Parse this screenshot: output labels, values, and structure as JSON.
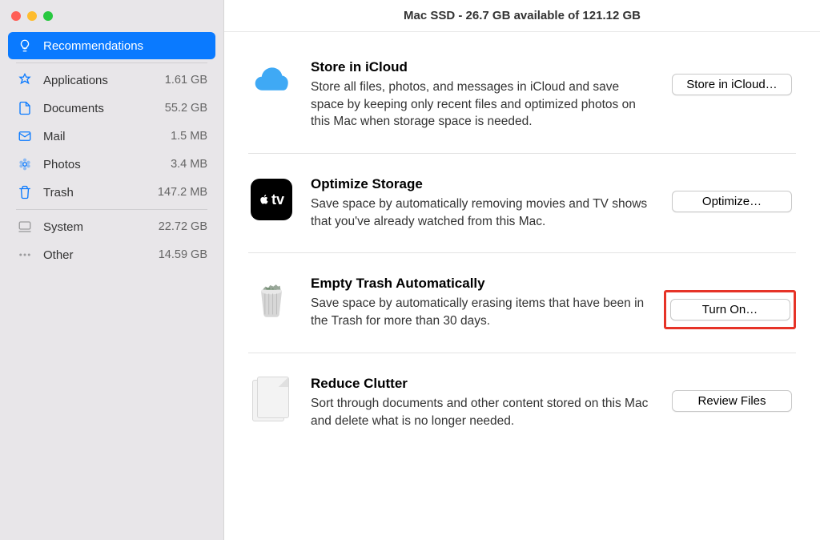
{
  "titlebar": "Mac SSD - 26.7 GB available of 121.12 GB",
  "sidebar": {
    "items": [
      {
        "label": "Recommendations",
        "size": ""
      },
      {
        "label": "Applications",
        "size": "1.61 GB"
      },
      {
        "label": "Documents",
        "size": "55.2 GB"
      },
      {
        "label": "Mail",
        "size": "1.5 MB"
      },
      {
        "label": "Photos",
        "size": "3.4 MB"
      },
      {
        "label": "Trash",
        "size": "147.2 MB"
      },
      {
        "label": "System",
        "size": "22.72 GB"
      },
      {
        "label": "Other",
        "size": "14.59 GB"
      }
    ]
  },
  "recommendations": [
    {
      "title": "Store in iCloud",
      "desc": "Store all files, photos, and messages in iCloud and save space by keeping only recent files and optimized photos on this Mac when storage space is needed.",
      "button": "Store in iCloud…"
    },
    {
      "title": "Optimize Storage",
      "desc": "Save space by automatically removing movies and TV shows that you've already watched from this Mac.",
      "button": "Optimize…"
    },
    {
      "title": "Empty Trash Automatically",
      "desc": "Save space by automatically erasing items that have been in the Trash for more than 30 days.",
      "button": "Turn On…"
    },
    {
      "title": "Reduce Clutter",
      "desc": "Sort through documents and other content stored on this Mac and delete what is no longer needed.",
      "button": "Review Files"
    }
  ]
}
